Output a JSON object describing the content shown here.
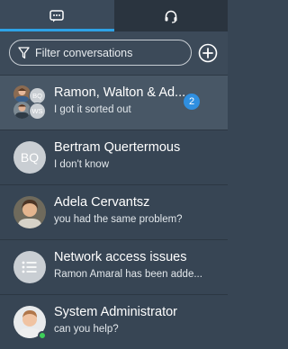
{
  "tabs": [
    {
      "label": "Chats",
      "icon": "chat-bubble-icon",
      "active": true
    },
    {
      "label": "Support",
      "icon": "headset-icon",
      "active": false
    }
  ],
  "search": {
    "placeholder": "Filter conversations"
  },
  "conversations": [
    {
      "name": "Ramon, Walton & Ad...",
      "preview": "I got it sorted out",
      "unread": "2",
      "avatar_initials": [
        "BQ",
        "WS"
      ]
    },
    {
      "name": "Bertram Quertermous",
      "preview": "I don't know",
      "avatar_initials": "BQ"
    },
    {
      "name": "Adela Cervantsz",
      "preview": "you had the same problem?"
    },
    {
      "name": "Network access issues",
      "preview": "Ramon Amaral has been adde..."
    },
    {
      "name": "System Administrator",
      "preview": "can you help?",
      "status": "online"
    }
  ],
  "colors": {
    "accent": "#2ea2e6",
    "badge": "#2f8fe0",
    "online": "#3ecf5a",
    "background": "#374554"
  }
}
